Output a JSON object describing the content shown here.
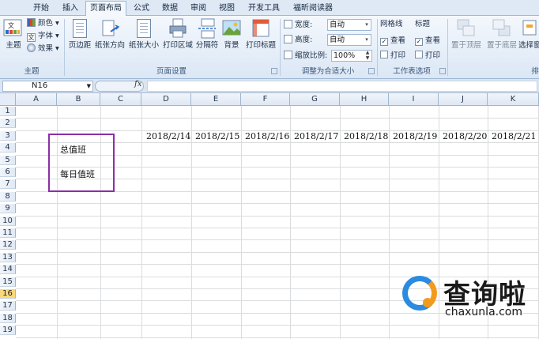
{
  "tabs": [
    "开始",
    "插入",
    "页面布局",
    "公式",
    "数据",
    "审阅",
    "视图",
    "开发工具",
    "福昕阅读器"
  ],
  "active_tab": "页面布局",
  "ribbon": {
    "theme_group": {
      "big": "主题",
      "small": [
        "颜色",
        "字体",
        "效果"
      ],
      "label": "主题"
    },
    "page_setup_group": {
      "buttons": [
        "页边距",
        "纸张方向",
        "纸张大小",
        "打印区域",
        "分隔符",
        "背景",
        "打印标题"
      ],
      "label": "页面设置"
    },
    "scale_group": {
      "width_label": "宽度:",
      "width_value": "自动",
      "height_label": "高度:",
      "height_value": "自动",
      "scale_label": "缩放比例:",
      "scale_value": "100%",
      "label": "调整为合适大小"
    },
    "sheet_options_group": {
      "gridlines_title": "网格线",
      "headings_title": "标题",
      "view_label": "查看",
      "print_label": "打印",
      "gridlines_view_checked": "✓",
      "headings_view_checked": "✓",
      "label": "工作表选项"
    },
    "arrange_group": {
      "buttons": [
        "置于顶层",
        "置于底层",
        "选择窗"
      ],
      "label": "排"
    }
  },
  "formula_bar": {
    "name_box": "N16",
    "fx": "fx",
    "formula": ""
  },
  "sheet": {
    "columns": [
      "A",
      "B",
      "C",
      "D",
      "E",
      "F",
      "G",
      "H",
      "I",
      "J",
      "K"
    ],
    "rows": [
      "1",
      "2",
      "3",
      "4",
      "5",
      "6",
      "7",
      "8",
      "9",
      "10",
      "11",
      "12",
      "13",
      "14",
      "15",
      "16",
      "17",
      "18",
      "19"
    ],
    "selected_row": "16",
    "dates": [
      "2018/2/14",
      "2018/2/15",
      "2018/2/16",
      "2018/2/17",
      "2018/2/18",
      "2018/2/19",
      "2018/2/20",
      "2018/2/21"
    ],
    "cell_b4": "总值班",
    "cell_b6": "每日值班"
  },
  "watermark": {
    "title": "查询啦",
    "url": "chaxunla.com"
  },
  "colors": {
    "highlight_box": "#8c2ea8",
    "selected_row": "#f7d97c",
    "ribbon": "#dbe7f5"
  }
}
